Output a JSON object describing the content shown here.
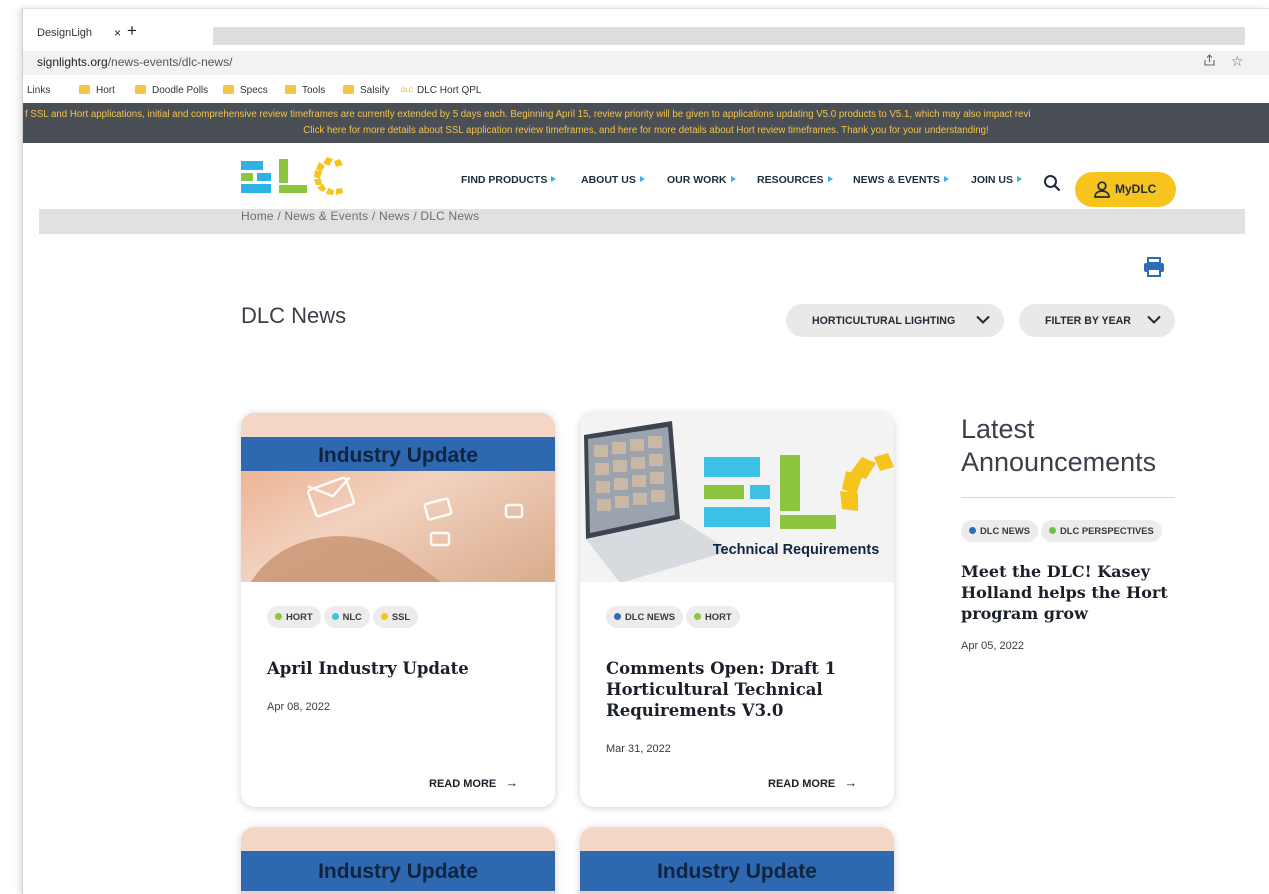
{
  "browser": {
    "tab_title": "DesignLigh",
    "tab_close": "×",
    "new_tab": "+",
    "url_host": "signlights.org",
    "url_path": "/news-events/dlc-news/",
    "bookmarks": [
      "Links",
      "Hort",
      "Doodle Polls",
      "Specs",
      "Tools",
      "Salsify",
      "DLC Hort QPL"
    ],
    "bookmark_dlc_mark": "DLC"
  },
  "notice": {
    "line1": "f SSL and Hort applications, initial and comprehensive review timeframes are currently extended by 5 days each. Beginning April 15, review priority will be given to applications updating V5.0 products to V5.1, which may also impact revi",
    "line2": "Click here for more details about SSL application review timeframes, and here for more details about Hort review timeframes. Thank you for your understanding!"
  },
  "header": {
    "nav": [
      "FIND PRODUCTS",
      "ABOUT US",
      "OUR WORK",
      "RESOURCES",
      "NEWS & EVENTS",
      "JOIN US"
    ],
    "mydlc_label": "MyDLC",
    "brand_colors": {
      "blue": "#2fb2e4",
      "green": "#8cc63f",
      "yellow": "#f7c31d",
      "navy": "#1e2b3c"
    }
  },
  "breadcrumb": "Home / News & Events / News / DLC News",
  "page": {
    "title": "DLC News",
    "filters": [
      "HORTICULTURAL LIGHTING",
      "FILTER BY YEAR"
    ]
  },
  "cards": [
    {
      "banner": "Industry Update",
      "tags": [
        {
          "label": "HORT",
          "color": "#8cc63f"
        },
        {
          "label": "NLC",
          "color": "#3ec1e6"
        },
        {
          "label": "SSL",
          "color": "#f7c31d"
        }
      ],
      "title": "April Industry Update",
      "date": "Apr 08, 2022",
      "read_more": "READ MORE"
    },
    {
      "banner": "Technical Requirements",
      "tags": [
        {
          "label": "DLC NEWS",
          "color": "#2d6db5"
        },
        {
          "label": "HORT",
          "color": "#8cc63f"
        }
      ],
      "title": "Comments Open: Draft 1 Horticultural Technical Requirements V3.0",
      "date": "Mar 31, 2022",
      "read_more": "READ MORE"
    },
    {
      "banner": "Industry Update"
    },
    {
      "banner": "Industry Update"
    }
  ],
  "sidebar": {
    "heading": "Latest Announcements",
    "tags": [
      {
        "label": "DLC NEWS",
        "color": "#2d6db5"
      },
      {
        "label": "DLC PERSPECTIVES",
        "color": "#6cc04a"
      }
    ],
    "title": "Meet the DLC! Kasey Holland helps the Hort program grow",
    "date": "Apr 05, 2022"
  }
}
